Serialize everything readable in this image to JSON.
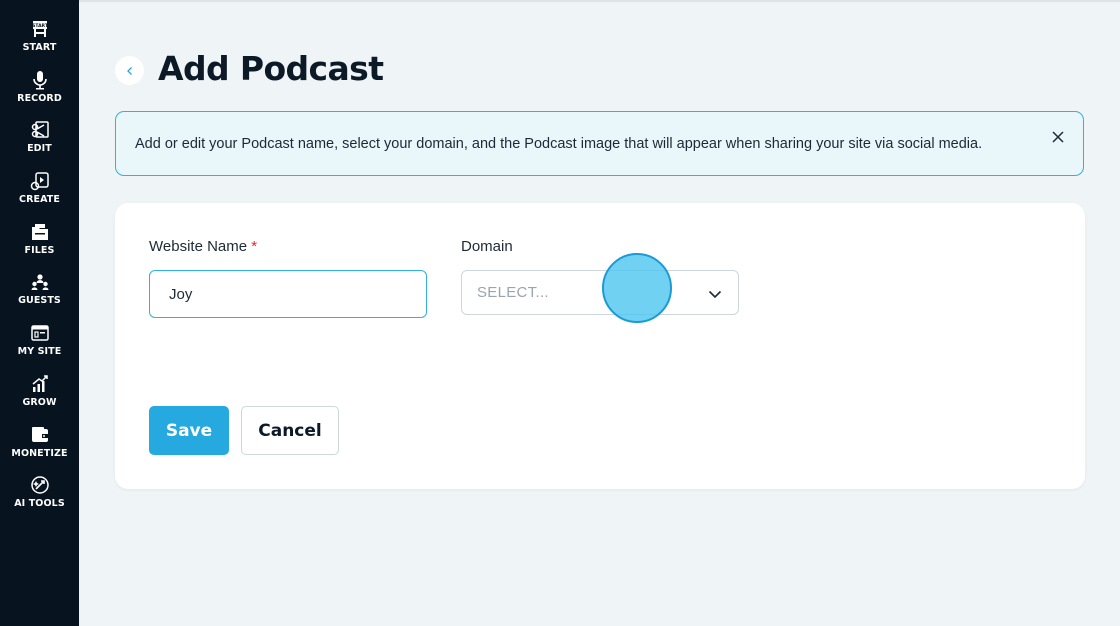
{
  "sidebar": {
    "items": [
      {
        "label": "START",
        "icon": "start-icon"
      },
      {
        "label": "RECORD",
        "icon": "microphone-icon"
      },
      {
        "label": "EDIT",
        "icon": "edit-icon"
      },
      {
        "label": "CREATE",
        "icon": "create-icon"
      },
      {
        "label": "FILES",
        "icon": "files-icon"
      },
      {
        "label": "GUESTS",
        "icon": "guests-icon"
      },
      {
        "label": "MY SITE",
        "icon": "site-icon"
      },
      {
        "label": "GROW",
        "icon": "grow-icon"
      },
      {
        "label": "MONETIZE",
        "icon": "monetize-icon"
      },
      {
        "label": "AI TOOLS",
        "icon": "ai-tools-icon"
      }
    ]
  },
  "header": {
    "title": "Add Podcast"
  },
  "banner": {
    "text": "Add or edit your Podcast name, select your domain, and the Podcast image that will appear when sharing your site via social media."
  },
  "form": {
    "website_name_label": "Website Name",
    "required_mark": "*",
    "website_name_value": "Joy",
    "domain_label": "Domain",
    "domain_placeholder": "SELECT..."
  },
  "actions": {
    "save_label": "Save",
    "cancel_label": "Cancel"
  },
  "colors": {
    "sidebar_bg": "#07131f",
    "accent": "#25a9df",
    "banner_bg": "#e9f6fa",
    "required": "#e0262f"
  }
}
